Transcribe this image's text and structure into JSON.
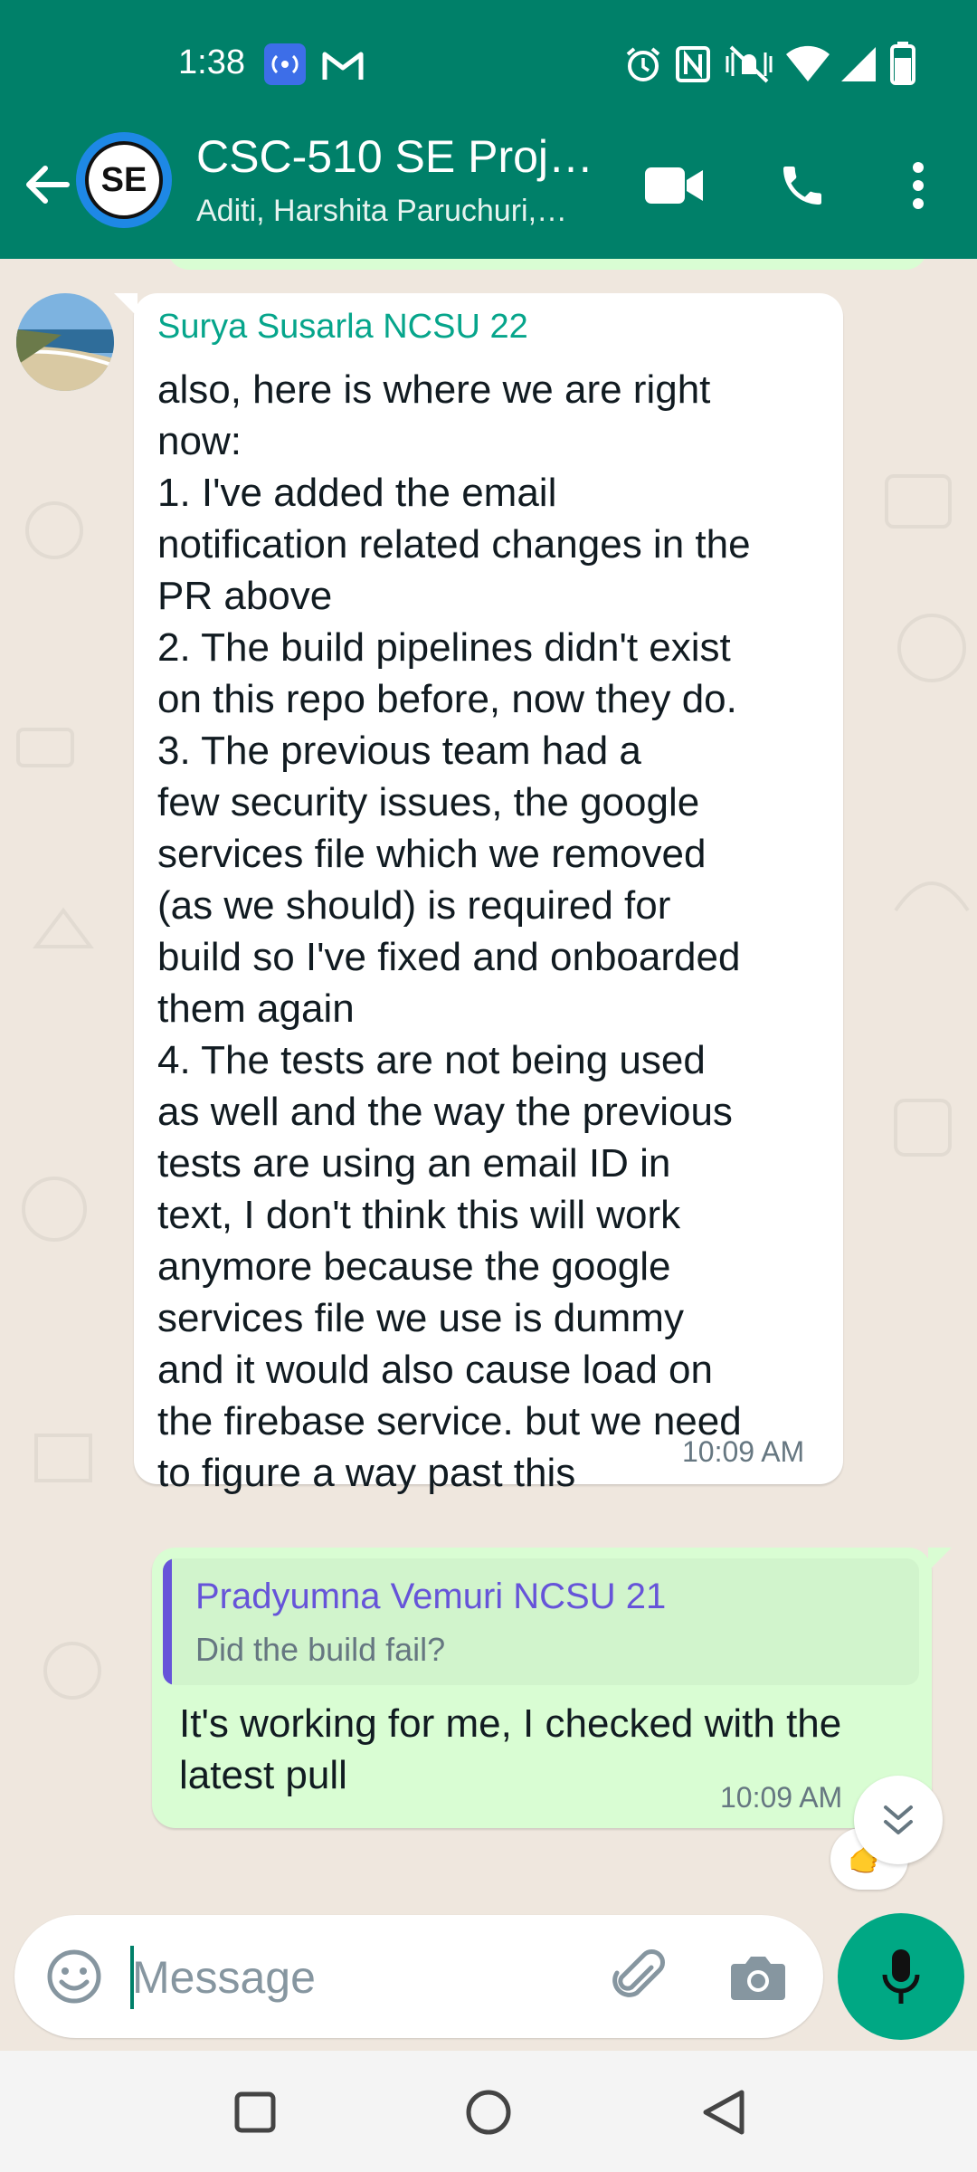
{
  "status_bar": {
    "time": "1:38"
  },
  "header": {
    "group_avatar_text": "SE",
    "title": "CSC-510 SE Proj…",
    "subtitle": "Aditi, Harshita Paruchuri,…"
  },
  "messages": [
    {
      "sender": "Surya Susarla NCSU 22",
      "text": "also, here is where we are right\nnow:\n1. I've added the email\nnotification related changes in the\nPR above\n2. The build pipelines didn't exist\non this repo before, now they do.\n3. The previous team had a\nfew security issues, the google\nservices file which we removed\n(as we should) is required for\nbuild so I've fixed and onboarded\nthem again\n4. The tests are not being used\nas well and the way the previous\ntests are using an email ID in\ntext, I don't think this will work\nanymore because the google\nservices file we use is dummy\nand it would also cause load on\nthe firebase service. but we need\nto figure a way past this",
      "time": "10:09 AM"
    },
    {
      "quoted_sender": "Pradyumna Vemuri NCSU 21",
      "quoted_text": "Did the build fail?",
      "text": "It's working for me, I checked with the latest pull",
      "time": "10:09 AM",
      "reaction": "👉"
    }
  ],
  "composer": {
    "placeholder": "Message"
  },
  "colors": {
    "header": "#008069",
    "outgoing_bubble": "#d9fdd3",
    "chat_background": "#efe7de",
    "sender_name": "#06a58b",
    "quote_accent": "#6654d9",
    "mic_button": "#00a884"
  },
  "icons": [
    "back-arrow-icon",
    "video-call-icon",
    "voice-call-icon",
    "more-options-icon",
    "emoji-icon",
    "attach-icon",
    "camera-icon",
    "mic-icon",
    "scroll-down-icon",
    "recents-icon",
    "home-icon",
    "back-nav-icon"
  ]
}
